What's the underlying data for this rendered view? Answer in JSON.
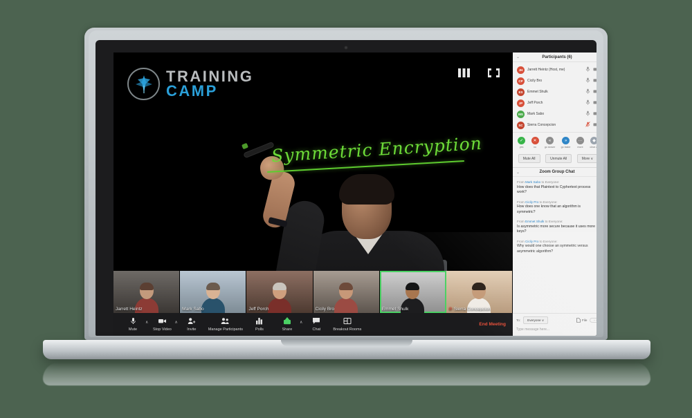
{
  "brand": {
    "logo_line1": "TRAINING",
    "logo_line2": "CAMP",
    "logo_icon": "eagle-emblem-icon",
    "accent_blue": "#2a9fd8",
    "accent_grey": "#b9bcbe"
  },
  "stage": {
    "whiteboard_text": "Symmetric Encryption",
    "whiteboard_ink_color": "#6ddc38",
    "view_controls": [
      {
        "name": "grid-view-icon",
        "label": "Gallery View"
      },
      {
        "name": "fullscreen-icon",
        "label": "Enter Full Screen"
      }
    ]
  },
  "filmstrip": [
    {
      "name": "Jarrett Heintz",
      "muted": false,
      "active": false
    },
    {
      "name": "Mark Sabo",
      "muted": false,
      "active": false
    },
    {
      "name": "Jeff Porch",
      "muted": false,
      "active": false
    },
    {
      "name": "Cicily Bro",
      "muted": false,
      "active": false
    },
    {
      "name": "Emmet Shulk",
      "muted": false,
      "active": true
    },
    {
      "name": "Sierra Concepcion",
      "muted": true,
      "active": false
    }
  ],
  "toolbar": {
    "items": [
      {
        "label": "Mute",
        "icon": "microphone-icon",
        "caret": true
      },
      {
        "label": "Stop Video",
        "icon": "video-camera-icon",
        "caret": true
      },
      {
        "label": "Invite",
        "icon": "invite-person-icon",
        "caret": false
      },
      {
        "label": "Manage Participants",
        "icon": "participants-icon",
        "caret": false
      },
      {
        "label": "Polls",
        "icon": "polls-bars-icon",
        "caret": false
      },
      {
        "label": "Share",
        "icon": "share-screen-icon",
        "caret": true
      },
      {
        "label": "Chat",
        "icon": "chat-bubble-icon",
        "caret": false
      },
      {
        "label": "Breakout Rooms",
        "icon": "breakout-rooms-icon",
        "caret": false
      }
    ],
    "end_meeting": "End Meeting",
    "end_meeting_color": "#e8503a"
  },
  "participants_panel": {
    "title": "Participants (6)",
    "collapse_icon": "chevron-down-icon",
    "rows": [
      {
        "initials": "JH",
        "name": "Jarrett Heintz (Host, me)",
        "color": "#d8503a",
        "mic": "microphone-icon",
        "muted": false,
        "cam": "video-camera-icon"
      },
      {
        "initials": "CP",
        "name": "Cicily Bro",
        "color": "#d8503a",
        "mic": "microphone-icon",
        "muted": false,
        "cam": "video-camera-icon"
      },
      {
        "initials": "ES",
        "name": "Emmet Shulk",
        "color": "#c4452f",
        "mic": "microphone-icon",
        "muted": false,
        "cam": "video-camera-icon"
      },
      {
        "initials": "JP",
        "name": "Jeff Porch",
        "color": "#d8503a",
        "mic": "microphone-icon",
        "muted": false,
        "cam": "video-camera-icon"
      },
      {
        "initials": "MS",
        "name": "Mark Sabo",
        "color": "#4aa94a",
        "mic": "microphone-icon",
        "muted": false,
        "cam": "video-camera-icon"
      },
      {
        "initials": "SC",
        "name": "Sierra Concepcion",
        "color": "#c4452f",
        "mic": "microphone-muted-icon",
        "muted": true,
        "cam": "video-camera-icon"
      }
    ],
    "reactions": [
      {
        "label": "yes",
        "glyph": "✓",
        "color": "#38b449",
        "name": "reaction-yes"
      },
      {
        "label": "no",
        "glyph": "✕",
        "color": "#d8503a",
        "name": "reaction-no"
      },
      {
        "label": "go slower",
        "glyph": "«",
        "color": "#8d8d8d",
        "name": "reaction-go-slower"
      },
      {
        "label": "go faster",
        "glyph": "»",
        "color": "#2f86c7",
        "name": "reaction-go-faster"
      },
      {
        "label": "more",
        "glyph": "···",
        "color": "#8d8d8d",
        "name": "reaction-more"
      },
      {
        "label": "clear all",
        "glyph": "◆",
        "color": "#9aa3ad",
        "name": "reaction-clear-all"
      }
    ],
    "buttons": [
      {
        "label": "Mute All",
        "name": "mute-all-button"
      },
      {
        "label": "Unmute All",
        "name": "unmute-all-button"
      },
      {
        "label": "More ∨",
        "name": "participants-more-button"
      }
    ]
  },
  "chat_panel": {
    "title": "Zoom Group Chat",
    "collapse_icon": "chevron-down-icon",
    "messages": [
      {
        "from_prefix": "From ",
        "sender": "Mark Sabo",
        "to": " to Everyone:",
        "text": "How does that Plaintext to Cyphertext process work?"
      },
      {
        "from_prefix": "From ",
        "sender": "Cicily Pro",
        "to": " to Everyone:",
        "text": "How does one know that an algorithm is symmetric?"
      },
      {
        "from_prefix": "From ",
        "sender": "Emmet Shulk",
        "to": " to Everyone:",
        "text": "Is asymmetric more secure because it uses more keys?"
      },
      {
        "from_prefix": "From ",
        "sender": "Cicily Pro",
        "to": " to Everyone:",
        "text": "Why would one choose an  symmetric versus asymmetric algorithm?"
      }
    ],
    "footer": {
      "to_label": "To:",
      "to_value": "Everyone ∨",
      "file_label": "File",
      "file_icon": "file-icon",
      "more_label": "···",
      "input_placeholder": "Type message here..."
    }
  }
}
